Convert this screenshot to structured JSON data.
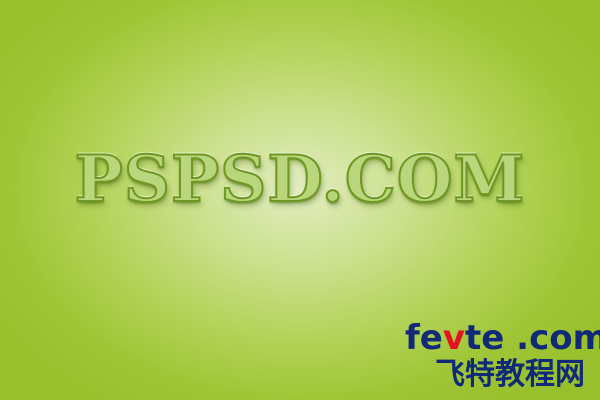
{
  "headline": {
    "text": "PSPSD.COM"
  },
  "watermark": {
    "domain_part1": "fe",
    "domain_accent": "v",
    "domain_part2": "te .com",
    "chinese": "飞特教程网"
  },
  "colors": {
    "background_center": "#e2edc0",
    "background_edge": "#98c02c",
    "headline_fill": "#b9d67c",
    "headline_outline": "#6f9722",
    "watermark_blue": "#102a78",
    "watermark_red": "#e3141f"
  }
}
